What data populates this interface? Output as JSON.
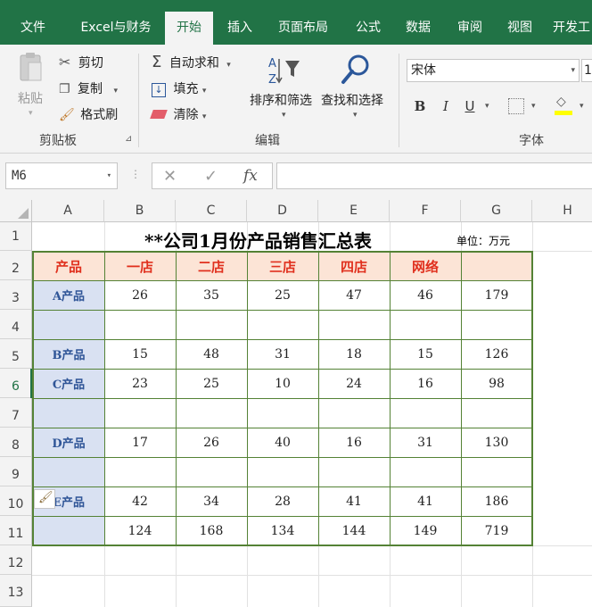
{
  "tabs": [
    "文件",
    "Excel与财务",
    "开始",
    "插入",
    "页面布局",
    "公式",
    "数据",
    "审阅",
    "视图",
    "开发工"
  ],
  "active_tab": "开始",
  "clipboard": {
    "paste": "粘贴",
    "cut": "剪切",
    "copy": "复制",
    "format_painter": "格式刷",
    "group_label": "剪贴板"
  },
  "editing": {
    "autosum": "自动求和",
    "fill": "填充",
    "clear": "清除",
    "sort_filter": "排序和筛选",
    "find_select": "查找和选择",
    "group_label": "编辑"
  },
  "font": {
    "font_name": "宋体",
    "font_size": "1",
    "bold": "B",
    "italic": "I",
    "underline": "U",
    "group_label": "字体"
  },
  "formula_bar": {
    "name_box": "M6",
    "fx": "fx",
    "formula": ""
  },
  "columns": [
    "A",
    "B",
    "C",
    "D",
    "E",
    "F",
    "G",
    "H"
  ],
  "rows": [
    "1",
    "2",
    "3",
    "4",
    "5",
    "6",
    "7",
    "8",
    "9",
    "10",
    "11",
    "12",
    "13"
  ],
  "sheet": {
    "title": "**公司1月份产品销售汇总表",
    "unit": "单位：万元",
    "headers": [
      "产品",
      "一店",
      "二店",
      "三店",
      "四店",
      "网络",
      ""
    ],
    "data_rows": [
      {
        "row": "3",
        "cells": [
          "A产品",
          "26",
          "35",
          "25",
          "47",
          "46",
          "179"
        ]
      },
      {
        "row": "4",
        "cells": [
          "",
          "",
          "",
          "",
          "",
          "",
          ""
        ]
      },
      {
        "row": "5",
        "cells": [
          "B产品",
          "15",
          "48",
          "31",
          "18",
          "15",
          "126"
        ]
      },
      {
        "row": "6",
        "cells": [
          "C产品",
          "23",
          "25",
          "10",
          "24",
          "16",
          "98"
        ]
      },
      {
        "row": "7",
        "cells": [
          "",
          "",
          "",
          "",
          "",
          "",
          ""
        ]
      },
      {
        "row": "8",
        "cells": [
          "D产品",
          "17",
          "26",
          "40",
          "16",
          "31",
          "130"
        ]
      },
      {
        "row": "9",
        "cells": [
          "",
          "",
          "",
          "",
          "",
          "",
          ""
        ]
      },
      {
        "row": "10",
        "cells": [
          "E产品",
          "42",
          "34",
          "28",
          "41",
          "41",
          "186"
        ]
      },
      {
        "row": "11",
        "cells": [
          "",
          "124",
          "168",
          "134",
          "144",
          "149",
          "719"
        ]
      }
    ]
  },
  "colors": {
    "excel_green": "#217346",
    "header_fill": "#fce4d6",
    "header_text": "#e0301e",
    "product_fill": "#d9e1f2",
    "product_text": "#2f5597",
    "table_border": "#548235"
  }
}
